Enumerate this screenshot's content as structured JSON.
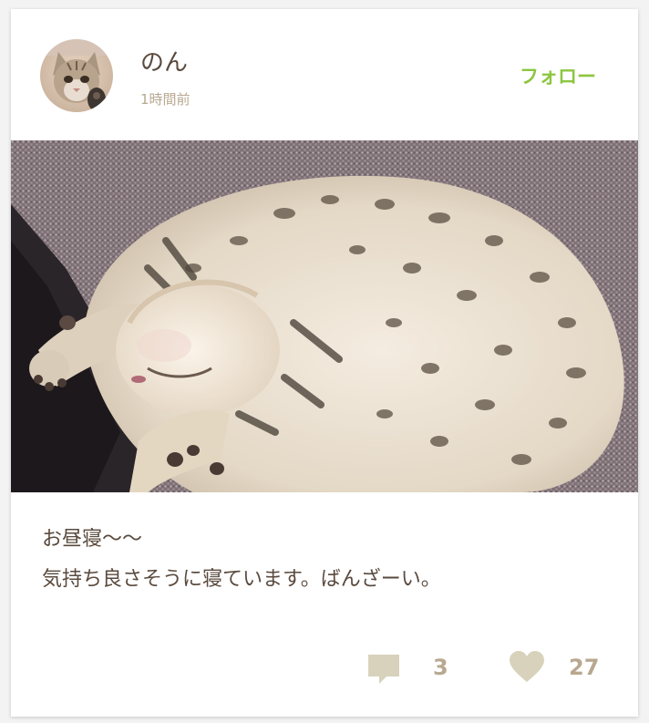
{
  "post": {
    "author_name": "のん",
    "posted_time": "1時間前",
    "follow_label": "フォロー",
    "caption_lines": [
      "お昼寝〜〜",
      "気持ち良さそうに寝ています。ばんざーい。"
    ],
    "comment_count": "3",
    "like_count": "27"
  },
  "icons": {
    "comment": "comment-bubble-icon",
    "like": "heart-icon"
  },
  "colors": {
    "accent_follow": "#8cc63f",
    "meta_text": "#b8a890",
    "body_text": "#5a4a3e",
    "icon_fill": "#d8d2bc"
  }
}
